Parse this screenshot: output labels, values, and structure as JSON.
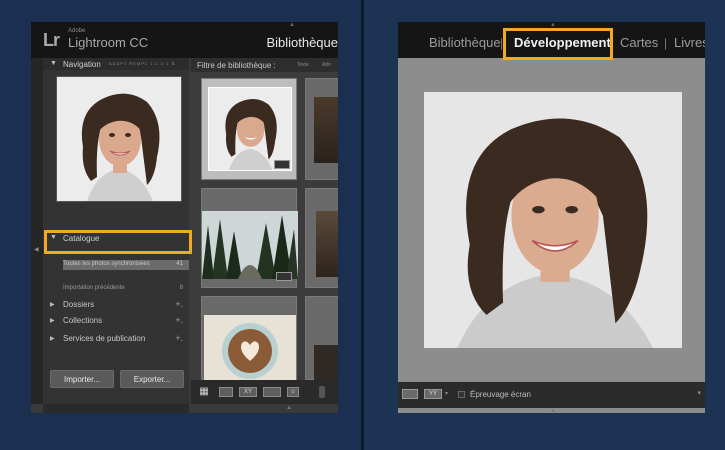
{
  "colors": {
    "highlight": "#f2a922",
    "background": "#1b3050"
  },
  "left_window": {
    "logo": "Lr",
    "brand": "Adobe",
    "product": "Lightroom CC",
    "module": "Bibliothèque",
    "navigator": {
      "title": "Navigation",
      "options": "ADAPT  REMPL  1:1  2:1  ⇅"
    },
    "catalog": {
      "title": "Catalogue",
      "rows": [
        {
          "label": "Toutes les photos synchronisées",
          "count": "41"
        },
        {
          "label": "Importation précédente",
          "count": "8"
        }
      ]
    },
    "sections": [
      {
        "label": "Dossiers"
      },
      {
        "label": "Collections"
      },
      {
        "label": "Services de publication"
      }
    ],
    "import_button": "Importer...",
    "export_button": "Exporter...",
    "grid": {
      "filter_label": "Filtre de bibliothèque :",
      "filter_option_text": "Texte",
      "filter_option_attr": "Attri"
    }
  },
  "right_window": {
    "tabs": [
      {
        "label": "Bibliothèque"
      },
      {
        "label": "Développement"
      },
      {
        "label": "Cartes"
      },
      {
        "label": "Livres"
      }
    ],
    "active_tab": "Développement",
    "soft_proof_label": "Épreuvage écran"
  },
  "icons": [
    "grid-view-icon",
    "loupe-view-icon",
    "compare-view-icon",
    "survey-view-icon",
    "people-view-icon",
    "panel-toggle-arrow-icon"
  ]
}
